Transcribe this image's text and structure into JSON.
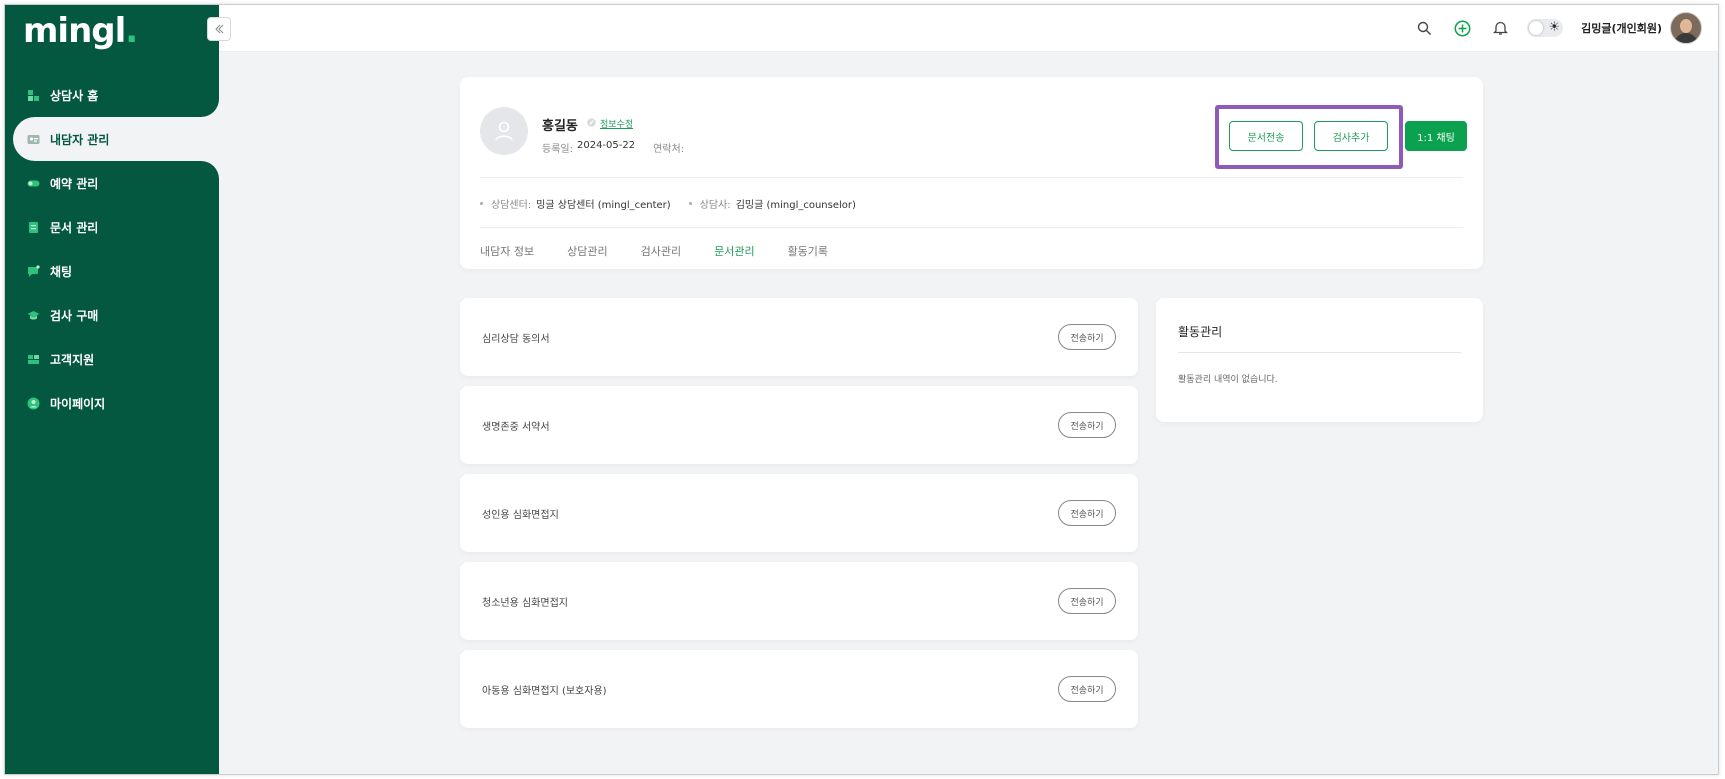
{
  "brand": {
    "logo": "mingl",
    "logo_dot": ".",
    "accent": "#03583f",
    "highlight": "#8e5cb8"
  },
  "sidebar": {
    "items": [
      {
        "label": "상담사 홈",
        "icon": "home-icon"
      },
      {
        "label": "내담자 관리",
        "icon": "client-card-icon",
        "active": true
      },
      {
        "label": "예약 관리",
        "icon": "toggle-icon"
      },
      {
        "label": "문서 관리",
        "icon": "document-icon"
      },
      {
        "label": "채팅",
        "icon": "chat-icon"
      },
      {
        "label": "검사 구매",
        "icon": "graduation-cap-icon"
      },
      {
        "label": "고객지원",
        "icon": "support-icon"
      },
      {
        "label": "마이페이지",
        "icon": "user-icon"
      }
    ]
  },
  "header": {
    "user_name": "김밍글(개인회원)"
  },
  "client": {
    "name": "홍길동",
    "edit_label": "정보수정",
    "reg_label": "등록일:",
    "reg_date": "2024-05-22",
    "contact_label": "연락처:",
    "contact_value": "",
    "center_label": "상담센터:",
    "center_value": "밍글 상담센터 (mingl_center)",
    "counselor_label": "상담사:",
    "counselor_value": "김밍글 (mingl_counselor)"
  },
  "actions": {
    "send_doc": "문서전송",
    "add_exam": "검사추가",
    "chat": "1:1 채팅"
  },
  "tabs": [
    {
      "label": "내담자 정보"
    },
    {
      "label": "상담관리"
    },
    {
      "label": "검사관리"
    },
    {
      "label": "문서관리",
      "active": true
    },
    {
      "label": "활동기록"
    }
  ],
  "documents": [
    {
      "title": "심리상담 동의서",
      "button": "전송하기"
    },
    {
      "title": "생명존중 서약서",
      "button": "전송하기"
    },
    {
      "title": "성인용 심화면접지",
      "button": "전송하기"
    },
    {
      "title": "청소년용 심화면접지",
      "button": "전송하기"
    },
    {
      "title": "아동용 심화면접지 (보호자용)",
      "button": "전송하기"
    }
  ],
  "activity": {
    "title": "활동관리",
    "empty": "활동관리 내역이 없습니다."
  }
}
